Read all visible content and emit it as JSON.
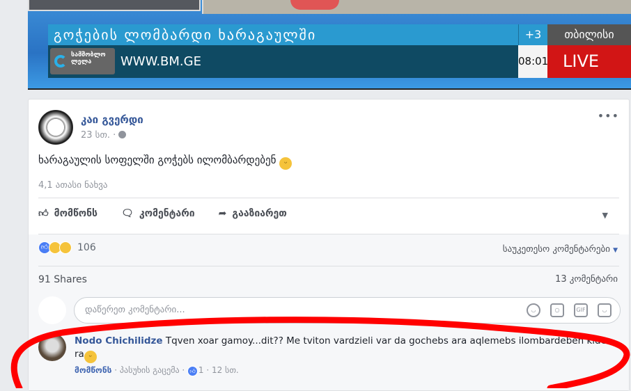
{
  "video": {
    "headline": "გოჭების ლომბარდი ხარაგაულში",
    "extra_count": "+3",
    "city": "თბილისი",
    "channel_logo": "სამშობლო ლელა",
    "url": "WWW.BM.GE",
    "time": "08:01",
    "live": "LIVE"
  },
  "post": {
    "author": "კაი გვერდი",
    "time": "23 სთ.",
    "separator": "·",
    "text": "ხარაგაულის სოფელში გოჭებს ილომბარდებენ",
    "views": "4,1 ათასი ნახვა",
    "menu": "•••"
  },
  "actions": {
    "like": "მომწონს",
    "comment": "კომენტარი",
    "share": "გააზიარეთ"
  },
  "reactions": {
    "count": "106",
    "sort": "საუკეთესო კომენტარები",
    "shares": "91 Shares",
    "comments_count": "13 კომენტარი"
  },
  "comment_input": {
    "placeholder": "დაწერეთ კომენტარი..."
  },
  "comment": {
    "author": "Nodo Chichilidze",
    "text": "Tqven xoar gamoy...dit?? Me tviton vardzieli var da gochebs ara aqlemebs ilombardeben kide ra",
    "like": "მომწონს",
    "reply": "პასუხის გაცემა",
    "likes": "1",
    "time": "12 სთ."
  }
}
